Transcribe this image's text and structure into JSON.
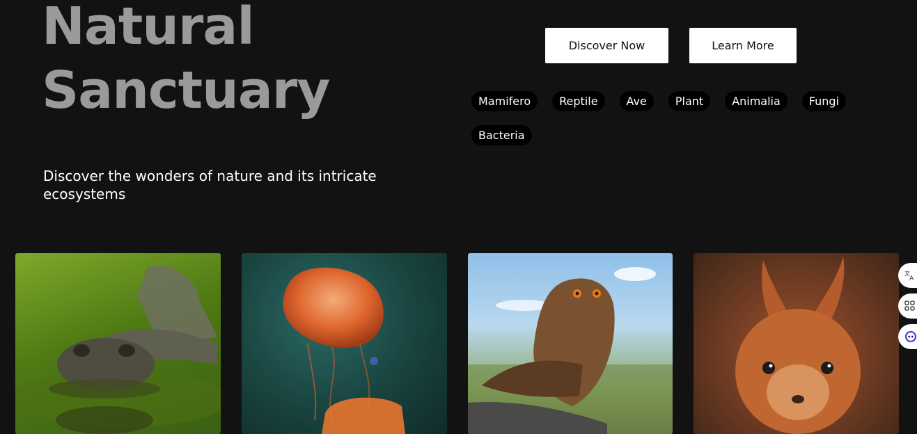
{
  "hero": {
    "title_line1": "Natural",
    "title_line2": "Sanctuary",
    "subtitle": "Discover the wonders of nature and its intricate ecosystems"
  },
  "actions": {
    "discover_label": "Discover Now",
    "learn_label": "Learn More"
  },
  "tags": [
    "Mamifero",
    "Reptile",
    "Ave",
    "Plant",
    "Animalia",
    "Fungi",
    "Bacteria"
  ],
  "gallery": [
    {
      "subject": "alligator",
      "icon": "alligator-image"
    },
    {
      "subject": "jellyfish",
      "icon": "jellyfish-image"
    },
    {
      "subject": "owl",
      "icon": "owl-image"
    },
    {
      "subject": "squirrel",
      "icon": "squirrel-image"
    }
  ],
  "side_widgets": [
    "translate-icon",
    "apps-grid-icon",
    "assistant-icon"
  ],
  "colors": {
    "background": "#121212",
    "title": "#9a9a9a",
    "button_bg": "#ffffff",
    "tag_bg": "#000000"
  }
}
